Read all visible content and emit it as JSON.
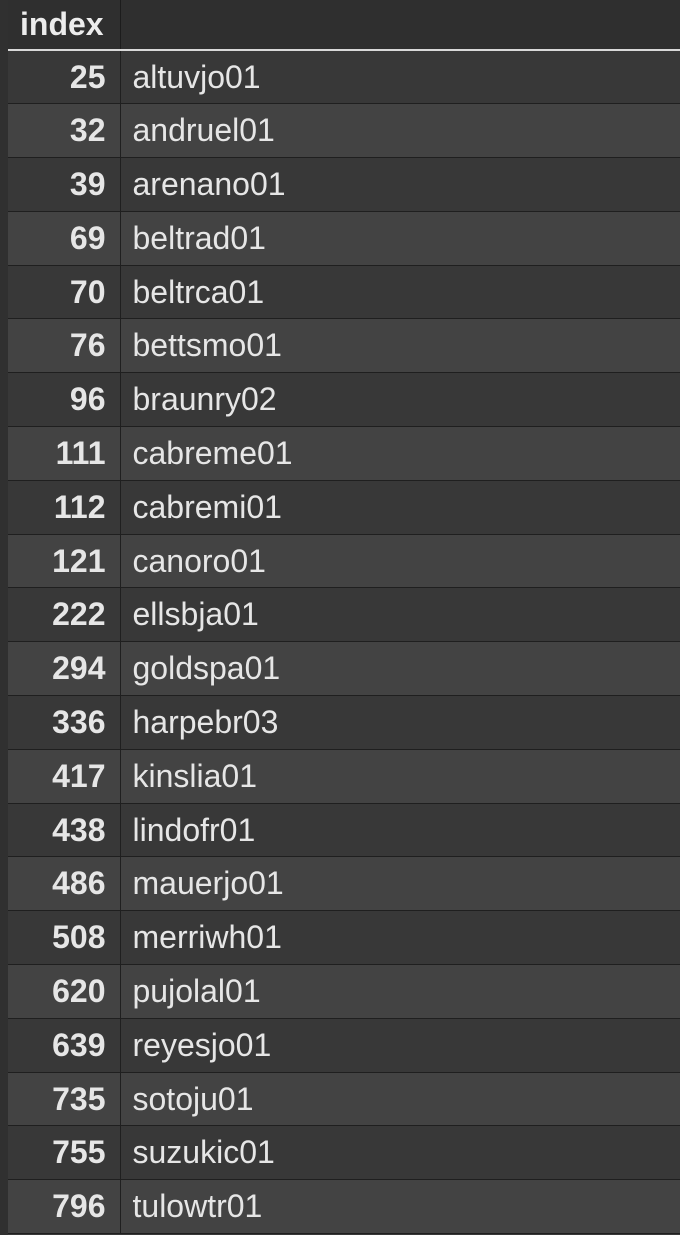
{
  "table": {
    "columns": [
      "index",
      ""
    ],
    "rows": [
      {
        "index": "25",
        "value": "altuvjo01"
      },
      {
        "index": "32",
        "value": "andruel01"
      },
      {
        "index": "39",
        "value": "arenano01"
      },
      {
        "index": "69",
        "value": "beltrad01"
      },
      {
        "index": "70",
        "value": "beltrca01"
      },
      {
        "index": "76",
        "value": "bettsmo01"
      },
      {
        "index": "96",
        "value": "braunry02"
      },
      {
        "index": "111",
        "value": "cabreme01"
      },
      {
        "index": "112",
        "value": "cabremi01"
      },
      {
        "index": "121",
        "value": "canoro01"
      },
      {
        "index": "222",
        "value": "ellsbja01"
      },
      {
        "index": "294",
        "value": "goldspa01"
      },
      {
        "index": "336",
        "value": "harpebr03"
      },
      {
        "index": "417",
        "value": "kinslia01"
      },
      {
        "index": "438",
        "value": "lindofr01"
      },
      {
        "index": "486",
        "value": "mauerjo01"
      },
      {
        "index": "508",
        "value": "merriwh01"
      },
      {
        "index": "620",
        "value": "pujolal01"
      },
      {
        "index": "639",
        "value": "reyesjo01"
      },
      {
        "index": "735",
        "value": "sotoju01"
      },
      {
        "index": "755",
        "value": "suzukic01"
      },
      {
        "index": "796",
        "value": "tulowtr01"
      }
    ]
  }
}
